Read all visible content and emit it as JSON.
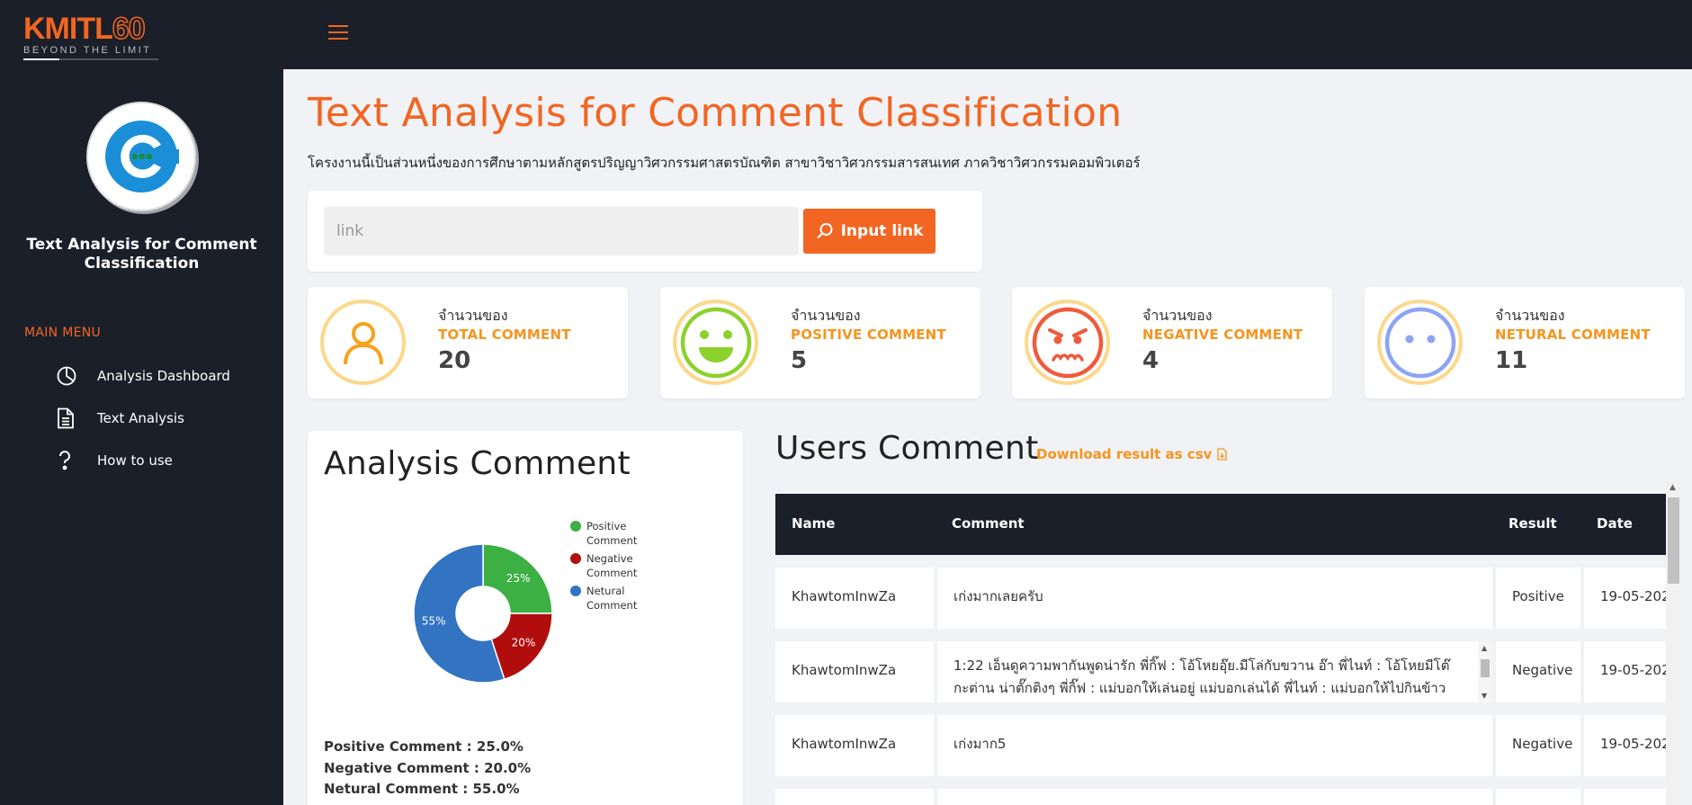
{
  "brand": {
    "logo_main_a": "KMITL",
    "logo_main_b": "60",
    "logo_sub": "BEYOND THE LIMIT"
  },
  "sidebar": {
    "app_title": "Text Analysis for Comment Classification",
    "menu_title": "MAIN MENU",
    "items": [
      {
        "label": "Analysis Dashboard",
        "icon": "pie-chart-icon"
      },
      {
        "label": "Text Analysis",
        "icon": "document-icon"
      },
      {
        "label": "How to use",
        "icon": "question-icon"
      }
    ]
  },
  "header": {
    "title": "Text Analysis for Comment Classification",
    "subtitle": "โครงงานนี้เป็นส่วนหนึ่งของการศึกษาตามหลักสูตรปริญญาวิศวกรรมศาสตรบัณฑิต สาขาวิชาวิศวกรรมสารสนเทศ ภาควิชาวิศวกรรมคอมพิวเตอร์"
  },
  "search": {
    "placeholder": "link",
    "button_label": "Input link"
  },
  "stats": [
    {
      "pre": "จำนวนของ",
      "label": "TOTAL COMMENT",
      "value": "20",
      "icon": "person-icon",
      "color": "#f7a21b"
    },
    {
      "pre": "จำนวนของ",
      "label": "POSITIVE COMMENT",
      "value": "5",
      "icon": "smile-face-icon",
      "color": "#8cd12c"
    },
    {
      "pre": "จำนวนของ",
      "label": "NEGATIVE COMMENT",
      "value": "4",
      "icon": "angry-face-icon",
      "color": "#f05a3a"
    },
    {
      "pre": "จำนวนของ",
      "label": "NETURAL COMMENT",
      "value": "11",
      "icon": "neutral-face-icon",
      "color": "#8ca4f5"
    }
  ],
  "analysis": {
    "title": "Analysis Comment",
    "lines": [
      "Positive Comment : 25.0%",
      "Negative Comment : 20.0%",
      "Netural Comment : 55.0%"
    ]
  },
  "chart_data": {
    "type": "pie",
    "categories": [
      "Positive Comment",
      "Negative Comment",
      "Netural Comment"
    ],
    "values": [
      25,
      20,
      55
    ],
    "labels": [
      "25%",
      "20%",
      "55%"
    ],
    "colors": [
      "#3cb043",
      "#b20d0d",
      "#3274c2"
    ],
    "legend": "right",
    "donut": true
  },
  "users": {
    "title": "Users Comment",
    "download_label": "Download result as csv",
    "columns": [
      "Name",
      "Comment",
      "Result",
      "Date"
    ],
    "rows": [
      {
        "name": "KhawtomInwZa",
        "comment": "เก่งมากเลยครับ",
        "result": "Positive",
        "date": "19-05-202"
      },
      {
        "name": "KhawtomInwZa",
        "comment": "1:22 เอ็นดูความพากันพูดน่ารัก พี่กิ๊ฟ : โอ้โหยอุ๊ย.มีโล่กับขวาน อ๊า พี่ไนท์ : โอ้โหยมีโต๊กะต่าน น่าตั๊กติงๆ พี่กิ๊ฟ : แม่บอกให้เล่นอยู่ แม่บอกเล่นได้ พี่ไนท์ : แม่บอกให้ไปกินข้าวก่อน ไม่ต้องเล่นให้ได้",
        "result": "Negative",
        "date": "19-05-202"
      },
      {
        "name": "KhawtomInwZa",
        "comment": "เก่งมาก5",
        "result": "Negative",
        "date": "19-05-202"
      }
    ]
  }
}
